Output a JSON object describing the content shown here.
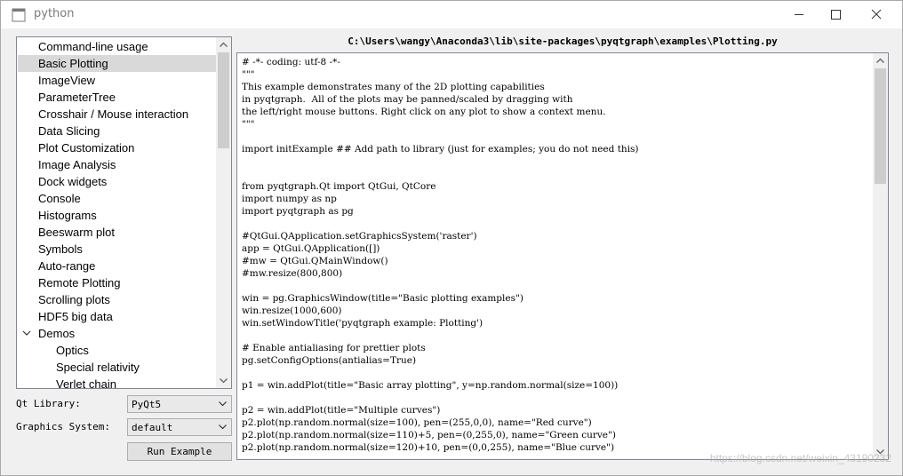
{
  "window": {
    "title": "python",
    "controls": {
      "minimize": "minimize",
      "maximize": "maximize",
      "close": "close"
    }
  },
  "examples": {
    "items": [
      {
        "label": "Command-line usage",
        "selected": false,
        "child": false
      },
      {
        "label": "Basic Plotting",
        "selected": true,
        "child": false
      },
      {
        "label": "ImageView",
        "selected": false,
        "child": false
      },
      {
        "label": "ParameterTree",
        "selected": false,
        "child": false
      },
      {
        "label": "Crosshair / Mouse interaction",
        "selected": false,
        "child": false
      },
      {
        "label": "Data Slicing",
        "selected": false,
        "child": false
      },
      {
        "label": "Plot Customization",
        "selected": false,
        "child": false
      },
      {
        "label": "Image Analysis",
        "selected": false,
        "child": false
      },
      {
        "label": "Dock widgets",
        "selected": false,
        "child": false
      },
      {
        "label": "Console",
        "selected": false,
        "child": false
      },
      {
        "label": "Histograms",
        "selected": false,
        "child": false
      },
      {
        "label": "Beeswarm plot",
        "selected": false,
        "child": false
      },
      {
        "label": "Symbols",
        "selected": false,
        "child": false
      },
      {
        "label": "Auto-range",
        "selected": false,
        "child": false
      },
      {
        "label": "Remote Plotting",
        "selected": false,
        "child": false
      },
      {
        "label": "Scrolling plots",
        "selected": false,
        "child": false
      },
      {
        "label": "HDF5 big data",
        "selected": false,
        "child": false
      },
      {
        "label": "Demos",
        "selected": false,
        "child": false,
        "expanded": true
      },
      {
        "label": "Optics",
        "selected": false,
        "child": true
      },
      {
        "label": "Special relativity",
        "selected": false,
        "child": true
      },
      {
        "label": "Verlet chain",
        "selected": false,
        "child": true
      }
    ]
  },
  "controls": {
    "qt_library_label": "Qt Library:",
    "qt_library_value": "PyQt5",
    "graphics_system_label": "Graphics System:",
    "graphics_system_value": "default",
    "run_button": "Run Example"
  },
  "code_view": {
    "path": "C:\\Users\\wangy\\Anaconda3\\lib\\site-packages\\pyqtgraph\\examples\\Plotting.py",
    "lines": [
      "# -*- coding: utf-8 -*-",
      "\"\"\"",
      "This example demonstrates many of the 2D plotting capabilities",
      "in pyqtgraph.  All of the plots may be panned/scaled by dragging with",
      "the left/right mouse buttons. Right click on any plot to show a context menu.",
      "\"\"\"",
      "",
      "import initExample ## Add path to library (just for examples; you do not need this)",
      "",
      "",
      "from pyqtgraph.Qt import QtGui, QtCore",
      "import numpy as np",
      "import pyqtgraph as pg",
      "",
      "#QtGui.QApplication.setGraphicsSystem('raster')",
      "app = QtGui.QApplication([])",
      "#mw = QtGui.QMainWindow()",
      "#mw.resize(800,800)",
      "",
      "win = pg.GraphicsWindow(title=\"Basic plotting examples\")",
      "win.resize(1000,600)",
      "win.setWindowTitle('pyqtgraph example: Plotting')",
      "",
      "# Enable antialiasing for prettier plots",
      "pg.setConfigOptions(antialias=True)",
      "",
      "p1 = win.addPlot(title=\"Basic array plotting\", y=np.random.normal(size=100))",
      "",
      "p2 = win.addPlot(title=\"Multiple curves\")",
      "p2.plot(np.random.normal(size=100), pen=(255,0,0), name=\"Red curve\")",
      "p2.plot(np.random.normal(size=110)+5, pen=(0,255,0), name=\"Green curve\")",
      "p2.plot(np.random.normal(size=120)+10, pen=(0,0,255), name=\"Blue curve\")"
    ]
  },
  "watermark": "https://blog.csdn.net/weixin_43190232"
}
